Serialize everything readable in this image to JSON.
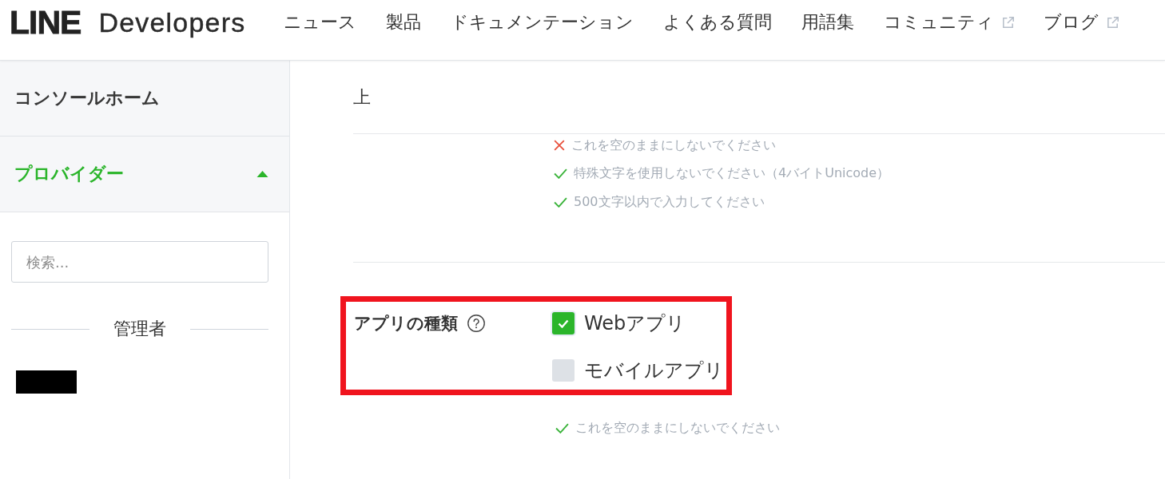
{
  "header": {
    "logo": {
      "mark": "LINE",
      "name": "Developers"
    },
    "nav": [
      {
        "label": "ニュース",
        "external": false
      },
      {
        "label": "製品",
        "external": false
      },
      {
        "label": "ドキュメンテーション",
        "external": false
      },
      {
        "label": "よくある質問",
        "external": false
      },
      {
        "label": "用語集",
        "external": false
      },
      {
        "label": "コミュニティ",
        "external": true
      },
      {
        "label": "ブログ",
        "external": true
      }
    ]
  },
  "sidebar": {
    "home": {
      "label": "コンソールホーム"
    },
    "providers_section": {
      "label": "プロバイダー",
      "expanded": true
    },
    "search": {
      "placeholder": "検索..."
    },
    "group_heading": "管理者",
    "providers": [
      {
        "kind": "redacted"
      }
    ]
  },
  "main": {
    "name_field": {
      "value": "上",
      "rules": [
        {
          "text": "これを空のままにしないでください",
          "passed": false
        },
        {
          "text": "特殊文字を使用しないでください（4バイトUnicode）",
          "passed": true
        },
        {
          "text": "500文字以内で入力してください",
          "passed": true
        }
      ]
    },
    "app_type": {
      "label": "アプリの種類",
      "highlighted": true,
      "options": [
        {
          "label": "Webアプリ",
          "checked": true
        },
        {
          "label": "モバイルアプリ",
          "checked": false
        }
      ],
      "rules": [
        {
          "text": "これを空のままにしないでください",
          "passed": true
        }
      ]
    }
  }
}
